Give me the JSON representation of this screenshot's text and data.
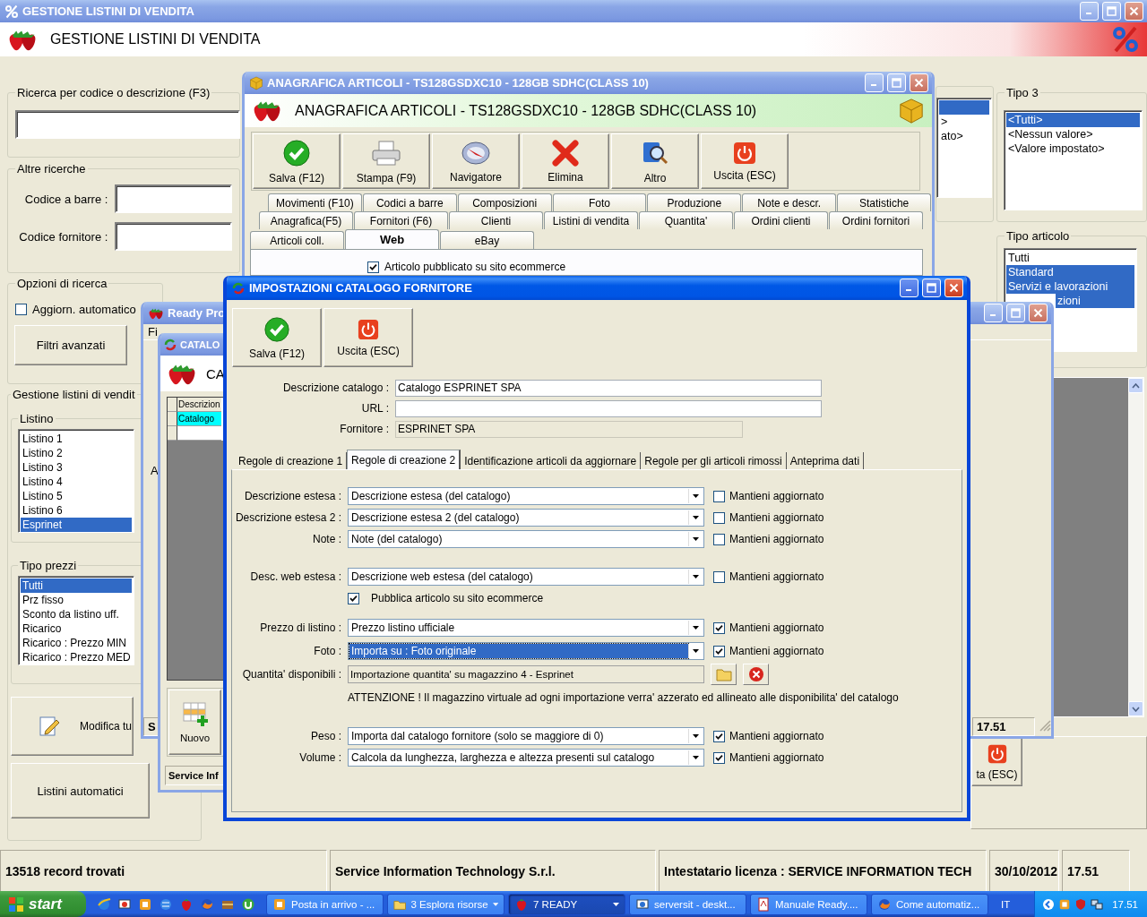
{
  "main_window": {
    "title": "GESTIONE LISTINI DI VENDITA",
    "header_title": "GESTIONE LISTINI DI VENDITA",
    "search": {
      "label": "Ricerca per codice o descrizione (F3)"
    },
    "other_searches": {
      "label": "Altre ricerche",
      "fields": [
        {
          "label": "Codice a barre :"
        },
        {
          "label": "Codice fornitore :"
        }
      ]
    },
    "search_options": {
      "label": "Opzioni di ricerca",
      "auto_update": {
        "label": "Aggiorn. automatico",
        "checked": false
      },
      "button": "Filtri avanzati"
    },
    "price_lists": {
      "label": "Gestione listini di vendit",
      "listino": {
        "label": "Listino",
        "items": [
          {
            "text": "Listino 1",
            "selected": false
          },
          {
            "text": "Listino 2",
            "selected": false
          },
          {
            "text": "Listino 3",
            "selected": false
          },
          {
            "text": "Listino 4",
            "selected": false
          },
          {
            "text": "Listino 5",
            "selected": false
          },
          {
            "text": "Listino 6",
            "selected": false
          },
          {
            "text": "Esprinet",
            "selected": true
          }
        ]
      },
      "price_types": {
        "label": "Tipo prezzi",
        "items": [
          {
            "text": "Tutti",
            "selected": true
          },
          {
            "text": "Prz fisso",
            "selected": false
          },
          {
            "text": "Sconto da listino uff.",
            "selected": false
          },
          {
            "text": "Ricarico",
            "selected": false
          },
          {
            "text": "Ricarico : Prezzo MIN",
            "selected": false
          },
          {
            "text": "Ricarico : Prezzo MED",
            "selected": false
          }
        ]
      },
      "edit_button": "Modifica tu",
      "auto_button": "Listini automatici"
    },
    "tipo2_list": {
      "items": [
        {
          "selected": true
        },
        {
          "text": ">",
          "selected": false
        },
        {
          "text": "ato>",
          "selected": false
        }
      ]
    },
    "tipo3": {
      "label": "Tipo 3",
      "items": [
        {
          "text": "<Tutti>",
          "selected": true
        },
        {
          "text": "<Nessun valore>",
          "selected": false
        },
        {
          "text": "<Valore impostato>",
          "selected": false
        }
      ]
    },
    "tipo_articolo": {
      "label": "Tipo articolo",
      "items": [
        {
          "text": "Tutti",
          "selected": false,
          "kind": "plain"
        },
        {
          "text": "Standard",
          "selected": true,
          "kind": "plain"
        },
        {
          "text": "Servizi e lavorazioni",
          "selected": true,
          "kind": "plain"
        },
        {
          "text": "zioni",
          "selected": true,
          "kind": "clipped"
        }
      ]
    },
    "exit_button": "ta (ESC)",
    "status_bar": [
      "13518 record trovati",
      "Service Information Technology S.r.l.",
      "Intestatario licenza : SERVICE INFORMATION TECH",
      "30/10/2012",
      "17.51"
    ]
  },
  "article_window": {
    "title": "ANAGRAFICA ARTICOLI - TS128GSDXC10 - 128GB SDHC(CLASS 10)",
    "header_title": "ANAGRAFICA ARTICOLI - TS128GSDXC10 - 128GB SDHC(CLASS 10)",
    "toolbar": [
      "Salva (F12)",
      "Stampa (F9)",
      "Navigatore",
      "Elimina",
      "Altro",
      "Uscita (ESC)"
    ],
    "tab_rows": [
      [
        {
          "label": "Movimenti (F10)",
          "selected": false
        },
        {
          "label": "Codici a barre",
          "selected": false
        },
        {
          "label": "Composizioni",
          "selected": false
        },
        {
          "label": "Foto",
          "selected": false
        },
        {
          "label": "Produzione",
          "selected": false
        },
        {
          "label": "Note e descr.",
          "selected": false
        },
        {
          "label": "Statistiche",
          "selected": false
        }
      ],
      [
        {
          "label": "Anagrafica(F5)",
          "selected": false
        },
        {
          "label": "Fornitori (F6)",
          "selected": false
        },
        {
          "label": "Clienti",
          "selected": false
        },
        {
          "label": "Listini di vendita",
          "selected": false
        },
        {
          "label": "Quantita'",
          "selected": false
        },
        {
          "label": "Ordini clienti",
          "selected": false
        },
        {
          "label": "Ordini fornitori",
          "selected": false
        }
      ],
      [
        {
          "label": "Articoli coll.",
          "selected": false
        },
        {
          "label": "Web",
          "selected": true
        },
        {
          "label": "eBay",
          "selected": false
        }
      ]
    ],
    "published": {
      "label": "Articolo pubblicato su sito ecommerce",
      "checked": true
    }
  },
  "readypro_window": {
    "title": "Ready Pro",
    "menu": "Fi",
    "label": "A",
    "status": [
      "S",
      "17.51"
    ]
  },
  "catalog_window": {
    "title": "CATALO",
    "header_title": "CA",
    "grid": {
      "column": "Descrizion",
      "rows": [
        {
          "text": "Catalogo",
          "selected": true
        }
      ]
    },
    "new_button": "Nuovo",
    "status": "Service Inf"
  },
  "settings_window": {
    "title": "IMPOSTAZIONI CATALOGO FORNITORE",
    "toolbar": [
      "Salva (F12)",
      "Uscita (ESC)"
    ],
    "fields": [
      {
        "label": "Descrizione catalogo :",
        "value": "Catalogo ESPRINET SPA",
        "readonly": false
      },
      {
        "label": "URL :",
        "readonly": false
      },
      {
        "label": "Fornitore :",
        "value": "ESPRINET SPA",
        "readonly": true
      }
    ],
    "tabs": [
      {
        "label": "Regole di creazione 1",
        "selected": false
      },
      {
        "label": "Regole di creazione 2",
        "selected": true
      },
      {
        "label": "Identificazione articoli da aggiornare",
        "selected": false
      },
      {
        "label": "Regole per gli articoli rimossi",
        "selected": false
      },
      {
        "label": "Anteprima dati",
        "selected": false
      }
    ],
    "sections": [
      [
        {
          "kind": "combo",
          "label": "Descrizione estesa :",
          "value": "Descrizione estesa (del catalogo)",
          "highlighted": false,
          "keep": {
            "label": "Mantieni aggiornato",
            "checked": false
          }
        },
        {
          "kind": "combo",
          "label": "Descrizione estesa 2 :",
          "value": "Descrizione estesa 2 (del catalogo)",
          "highlighted": false,
          "keep": {
            "label": "Mantieni aggiornato",
            "checked": false
          }
        },
        {
          "kind": "combo",
          "label": "Note :",
          "value": "Note (del catalogo)",
          "highlighted": false,
          "keep": {
            "label": "Mantieni aggiornato",
            "checked": false
          }
        }
      ],
      [
        {
          "kind": "combo",
          "label": "Desc. web estesa :",
          "value": "Descrizione web estesa (del catalogo)",
          "highlighted": false,
          "keep": {
            "label": "Mantieni aggiornato",
            "checked": false
          }
        },
        {
          "kind": "check",
          "label": "Pubblica articolo su sito ecommerce",
          "checked": true
        }
      ],
      [
        {
          "kind": "combo",
          "label": "Prezzo di listino :",
          "value": "Prezzo listino ufficiale",
          "highlighted": false,
          "keep": {
            "label": "Mantieni aggiornato",
            "checked": true
          }
        },
        {
          "kind": "combo",
          "label": "Foto :",
          "value": "Importa su : Foto originale",
          "highlighted": true,
          "keep": {
            "label": "Mantieni aggiornato",
            "checked": true
          }
        },
        {
          "kind": "readonly",
          "label": "Quantita' disponibili :",
          "value": "Importazione quantita' su magazzino 4 - Esprinet"
        },
        {
          "kind": "note",
          "text": "ATTENZIONE ! Il magazzino virtuale ad ogni importazione verra' azzerato ed allineato alle disponibilita' del catalogo"
        }
      ],
      [
        {
          "kind": "combo",
          "label": "Peso :",
          "value": "Importa dal catalogo fornitore (solo se maggiore di 0)",
          "highlighted": false,
          "keep": {
            "label": "Mantieni aggiornato",
            "checked": true
          }
        },
        {
          "kind": "combo",
          "label": "Volume :",
          "value": "Calcola da lunghezza, larghezza e altezza presenti sul catalogo",
          "highlighted": false,
          "keep": {
            "label": "Mantieni aggiornato",
            "checked": true
          }
        }
      ]
    ]
  },
  "taskbar": {
    "start": "start",
    "tasks": [
      {
        "label": "Posta in arrivo - ...",
        "selected": false,
        "grouped": false
      },
      {
        "label": "3 Esplora risorse",
        "selected": false,
        "grouped": true
      },
      {
        "label": "7 READY",
        "selected": true,
        "grouped": true
      },
      {
        "label": "serversit - deskt...",
        "selected": false,
        "grouped": false
      },
      {
        "label": "Manuale Ready....",
        "selected": false,
        "grouped": false
      },
      {
        "label": "Come automatiz...",
        "selected": false,
        "grouped": false
      }
    ],
    "language": "IT",
    "clock": "17.51"
  }
}
